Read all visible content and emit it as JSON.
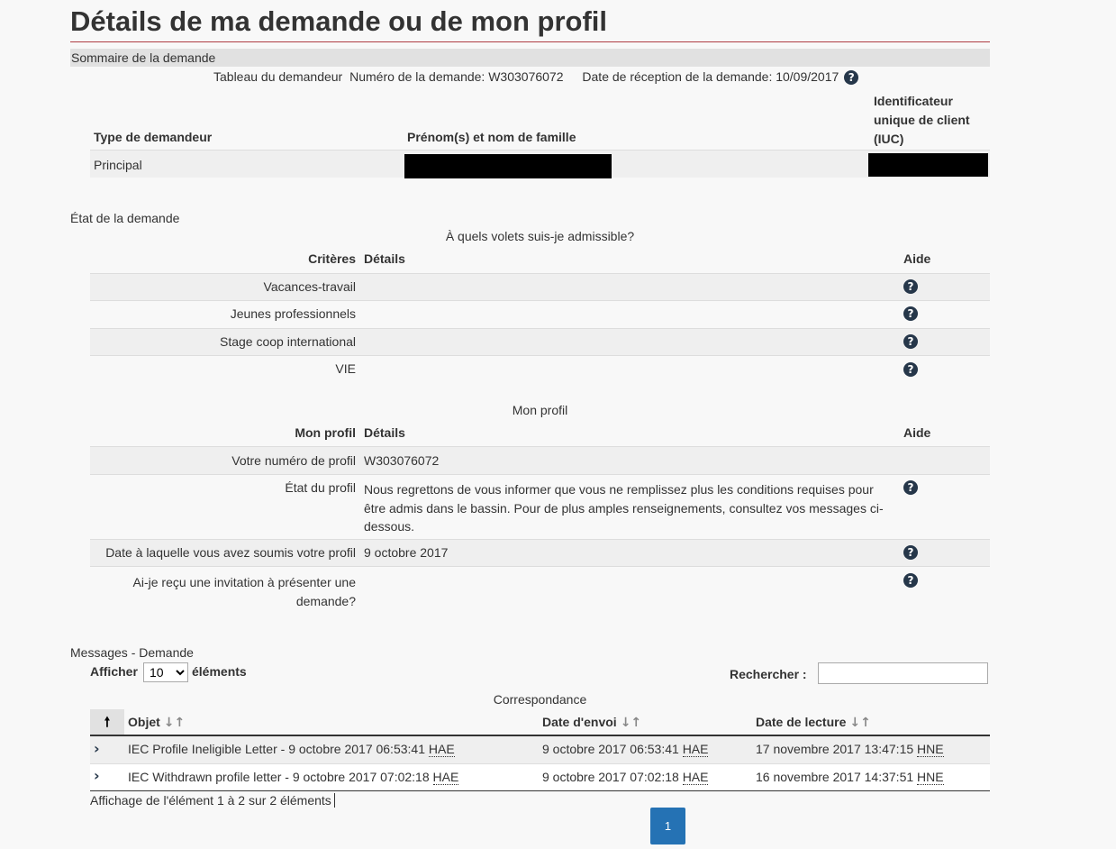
{
  "page": {
    "title": "Détails de ma demande ou de mon profil"
  },
  "summary": {
    "section_title": "Sommaire de la demande",
    "table_caption": "Tableau du demandeur",
    "application_number_text": "Numéro de la demande: W303076072",
    "received_date_text": "Date de réception de la demande: 10/09/2017",
    "headers": {
      "type": "Type de demandeur",
      "name": "Prénom(s) et nom de famille",
      "uci_line1": "Identificateur",
      "uci_line2": "unique de client",
      "uci_line3": "(IUC)"
    },
    "rows": [
      {
        "type": "Principal",
        "name": "[redacted]",
        "uci": "[redacted]"
      }
    ]
  },
  "status": {
    "section_title": "État de la demande",
    "eligibility": {
      "caption": "À quels volets suis-je admissible?",
      "headers": {
        "criteria": "Critères",
        "details": "Détails",
        "help": "Aide"
      },
      "rows": [
        {
          "label": "Vacances-travail",
          "details": ""
        },
        {
          "label": "Jeunes professionnels",
          "details": ""
        },
        {
          "label": "Stage coop international",
          "details": ""
        },
        {
          "label": "VIE",
          "details": ""
        }
      ]
    },
    "profile": {
      "caption": "Mon profil",
      "headers": {
        "label": "Mon profil",
        "details": "Détails",
        "help": "Aide"
      },
      "rows": [
        {
          "label": "Votre numéro de profil",
          "details": "W303076072",
          "help": false
        },
        {
          "label": "État du profil",
          "details": "Nous regrettons de vous informer que vous ne remplissez plus les conditions requises pour être admis dans le bassin. Pour de plus amples renseignements, consultez vos messages ci-dessous.",
          "help": true
        },
        {
          "label": "Date à laquelle vous avez soumis votre profil",
          "details": "9 octobre 2017",
          "help": true
        },
        {
          "label": "Ai-je reçu une invitation à présenter une demande?",
          "details": "",
          "help": true
        }
      ]
    }
  },
  "messages": {
    "section_title": "Messages - Demande",
    "show_label": "Afficher",
    "show_value": "10",
    "show_options": [
      "10"
    ],
    "entries_label": "éléments",
    "search_label": "Rechercher :",
    "search_value": "",
    "caption": "Correspondance",
    "headers": {
      "subject": "Objet",
      "sent": "Date d'envoi",
      "read": "Date de lecture"
    },
    "rows": [
      {
        "subject": "IEC Profile Ineligible Letter - 9 octobre 2017 06:53:41",
        "subject_tz": "HAE",
        "sent": "9 octobre 2017 06:53:41",
        "sent_tz": "HAE",
        "read": "17 novembre 2017 13:47:15",
        "read_tz": "HNE"
      },
      {
        "subject": "IEC Withdrawn profile letter - 9 octobre 2017 07:02:18",
        "subject_tz": "HAE",
        "sent": "9 octobre 2017 07:02:18",
        "sent_tz": "HAE",
        "read": "16 novembre 2017 14:37:51",
        "read_tz": "HNE"
      }
    ],
    "info": "Affichage de l'élément 1 à 2 sur 2 éléments",
    "current_page": "1"
  },
  "icons": {
    "help": "question-circle-icon",
    "expand": "chevron-right-icon",
    "sort": "sort-icon",
    "sort_asc": "arrow-up-icon"
  },
  "colors": {
    "title_rule": "#af3c43",
    "icon": "#26374a",
    "page_button": "#2572b4"
  }
}
